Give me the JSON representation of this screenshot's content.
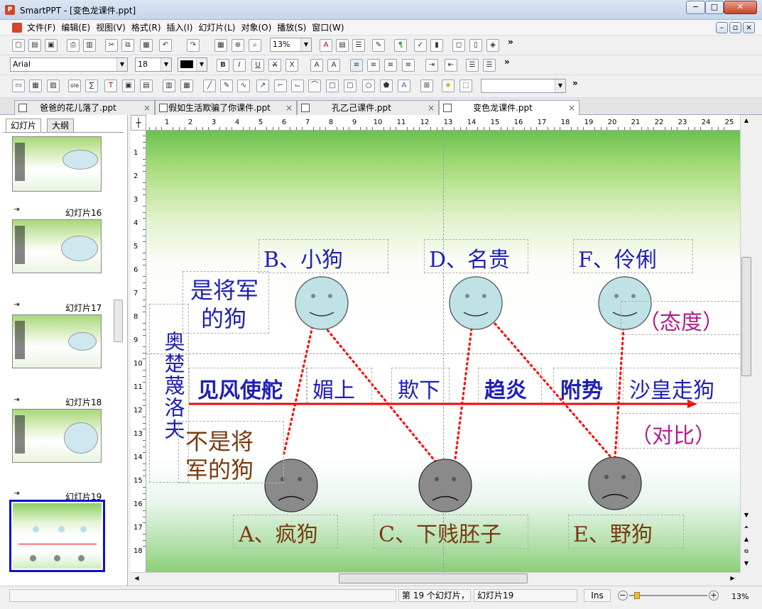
{
  "window": {
    "title": "SmartPPT - [变色龙课件.ppt]",
    "app_icon": "P",
    "minimize": "−",
    "maximize": "□",
    "close": "✕"
  },
  "menu": [
    "文件(F)",
    "编辑(E)",
    "视图(V)",
    "格式(R)",
    "插入(I)",
    "幻灯片(L)",
    "对象(O)",
    "播放(S)",
    "窗口(W)"
  ],
  "toolbar": {
    "zoom": "13%",
    "font": "Arial",
    "size": "18",
    "more": "»"
  },
  "tabs": [
    {
      "label": "爸爸的花儿落了.ppt"
    },
    {
      "label": "假如生活欺骗了你课件.ppt"
    },
    {
      "label": "孔乙己课件.ppt"
    },
    {
      "label": "变色龙课件.ppt"
    }
  ],
  "panel": {
    "tab_slides": "幻灯片",
    "tab_outline": "大纲"
  },
  "thumbnails": [
    {
      "label": ""
    },
    {
      "label": "幻灯片16"
    },
    {
      "label": "幻灯片17"
    },
    {
      "label": "幻灯片18"
    },
    {
      "label": "幻灯片19"
    }
  ],
  "slide": {
    "b": "B、小狗",
    "d": "D、名贵",
    "f": "F、伶俐",
    "a": "A、疯狗",
    "c": "C、下贱胚子",
    "e": "E、野狗",
    "general_dog_1": "是将军",
    "general_dog_2": "的狗",
    "not_general_1": "不是将",
    "not_general_2": "军的狗",
    "name_vertical": "奥楚蔑洛夫",
    "w1": "见风使舵",
    "w2": "媚上",
    "w3": "欺下",
    "w4": "趋炎",
    "w5": "附势",
    "w6": "沙皇走狗",
    "attitude": "（态度）",
    "contrast": "（对比）"
  },
  "ruler_h": [
    "1",
    "2",
    "3",
    "4",
    "5",
    "6",
    "7",
    "8",
    "9",
    "10",
    "11",
    "12",
    "13",
    "14",
    "15",
    "16",
    "17",
    "18",
    "19",
    "20",
    "21",
    "22",
    "23",
    "24",
    "25"
  ],
  "ruler_v": [
    "1",
    "2",
    "3",
    "4",
    "5",
    "6",
    "7",
    "8",
    "9",
    "10",
    "11",
    "12",
    "13",
    "14",
    "15",
    "16",
    "17",
    "18"
  ],
  "status": {
    "slide_pos": "第 19 个幻灯片，",
    "slide_name": "幻灯片19",
    "mode": "Ins",
    "zoom": "13%"
  },
  "colors": {
    "blue": "#1f1fb8",
    "brown": "#7a3a10",
    "magenta": "#b0208a",
    "arrow": "#ff0000"
  }
}
